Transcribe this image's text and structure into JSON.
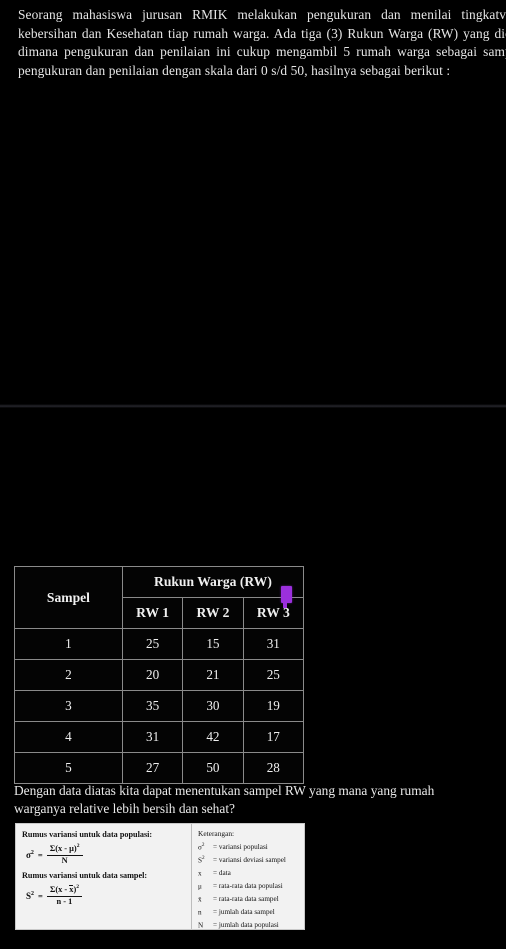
{
  "document": {
    "list_marker": ".",
    "intro_paragraph": "Seorang mahasiswa jurusan RMIK melakukan pengukuran dan menilai tingkatvariabilitas kebersihan dan Kesehatan tiap rumah warga. Ada tiga (3) Rukun Warga (RW) yang diobservasi, dimana pengukuran dan penilaian ini cukup mengambil 5 rumah warga sebagai sampel. Hasil pengukuran dan penilaian dengan skala dari 0 s/d 50, hasilnya sebagai berikut :",
    "question": "Dengan data diatas kita dapat menentukan sampel RW yang mana yang rumah warganya relative lebih bersih dan sehat?"
  },
  "table": {
    "group_header": "Rukun Warga (RW)",
    "row_header": "Sampel",
    "columns": [
      "RW 1",
      "RW 2",
      "RW 3"
    ],
    "rows": [
      {
        "sampel": "1",
        "rw1": "25",
        "rw2": "15",
        "rw3": "31"
      },
      {
        "sampel": "2",
        "rw1": "20",
        "rw2": "21",
        "rw3": "25"
      },
      {
        "sampel": "3",
        "rw1": "35",
        "rw2": "30",
        "rw3": "19"
      },
      {
        "sampel": "4",
        "rw1": "31",
        "rw2": "42",
        "rw3": "17"
      },
      {
        "sampel": "5",
        "rw1": "27",
        "rw2": "50",
        "rw3": "28"
      }
    ]
  },
  "formula_figure": {
    "population_title": "Rumus variansi untuk data populasi:",
    "population_lhs": "σ",
    "population_lhs_sup": "2",
    "population_numerator": "Σ(x - μ)",
    "population_numerator_sup": "2",
    "population_denominator": "N",
    "sample_title": "Rumus variansi untuk data sampel:",
    "sample_lhs": "S",
    "sample_lhs_sup": "2",
    "sample_numerator_pre": "Σ(x - ",
    "sample_numerator_bar": "x",
    "sample_numerator_post": ")",
    "sample_numerator_sup": "2",
    "sample_denominator": "n - 1",
    "keterangan_title": "Keterangan:",
    "keterangan": [
      {
        "symbol": "σ",
        "sup": "2",
        "definition": "= variansi populasi"
      },
      {
        "symbol": "S",
        "sup": "2",
        "definition": "= variansi deviasi sampel"
      },
      {
        "symbol": "x",
        "sup": "",
        "definition": "= data"
      },
      {
        "symbol": "μ",
        "sup": "",
        "definition": "= rata-rata data populasi"
      },
      {
        "symbol": "x̄",
        "sup": "",
        "definition": "= rata-rata data sampel"
      },
      {
        "symbol": "n",
        "sup": "",
        "definition": "= jumlah data sampel"
      },
      {
        "symbol": "N",
        "sup": "",
        "definition": "= jumlah data populasi"
      }
    ]
  },
  "cursor": {
    "color": "#9b30dd",
    "label": "text-cursor-marker"
  }
}
